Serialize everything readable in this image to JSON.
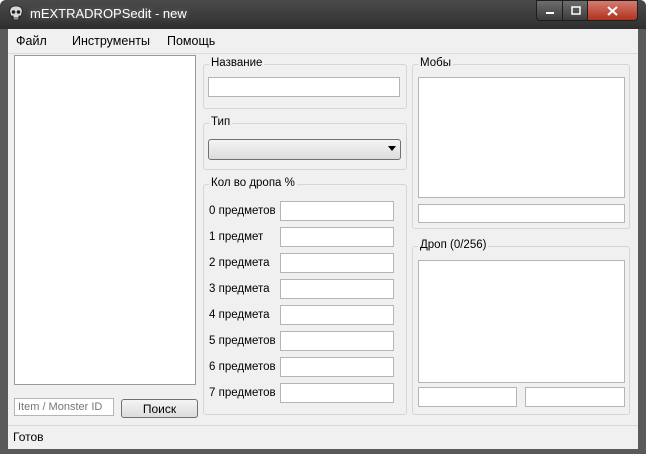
{
  "window": {
    "title": "mEXTRADROPSedit - new",
    "icons": {
      "app": "skull-icon",
      "minimize": "minimize-icon",
      "maximize": "maximize-icon",
      "close": "close-icon"
    }
  },
  "menu": {
    "items": [
      "Файл",
      "Инструменты",
      "Помощь"
    ]
  },
  "search": {
    "placeholder": "Item / Monster ID",
    "button_label": "Поиск"
  },
  "name_group": {
    "label": "Название",
    "value": ""
  },
  "type_group": {
    "label": "Тип",
    "selected": ""
  },
  "drop_count_group": {
    "label": "Кол во дропа %",
    "rows": [
      {
        "label": "0 предметов",
        "value": ""
      },
      {
        "label": "1 предмет",
        "value": ""
      },
      {
        "label": "2 предмета",
        "value": ""
      },
      {
        "label": "3 предмета",
        "value": ""
      },
      {
        "label": "4 предмета",
        "value": ""
      },
      {
        "label": "5 предметов",
        "value": ""
      },
      {
        "label": "6 предметов",
        "value": ""
      },
      {
        "label": "7 предметов",
        "value": ""
      }
    ]
  },
  "mobs_group": {
    "label": "Мобы"
  },
  "drop_group": {
    "label": "Дроп (0/256)"
  },
  "status": {
    "text": "Готов"
  }
}
